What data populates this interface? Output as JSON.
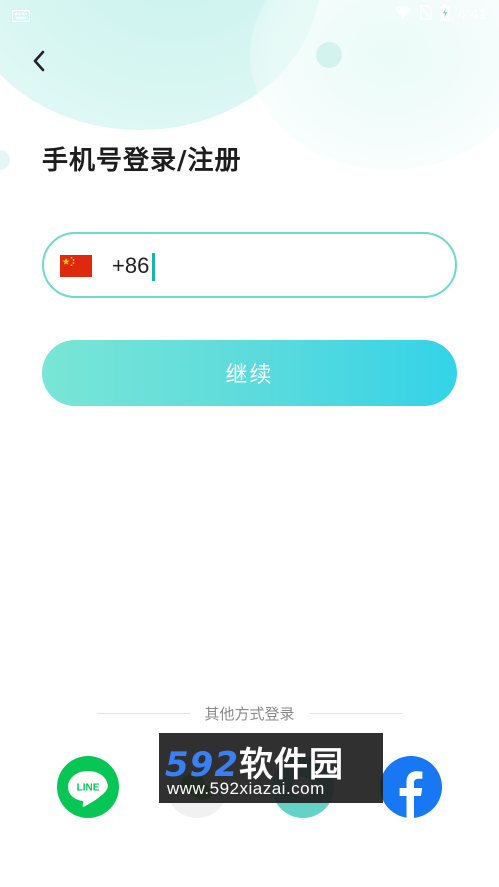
{
  "status_bar": {
    "time": "4:41"
  },
  "page": {
    "title": "手机号登录/注册"
  },
  "phone": {
    "country_code": "+86",
    "flag": "cn-flag"
  },
  "actions": {
    "continue_label": "继续"
  },
  "other_login": {
    "label": "其他方式登录",
    "providers": [
      {
        "name": "LINE",
        "color": "#06c755"
      },
      {
        "name": "wechat",
        "color": "#f1f1f1"
      },
      {
        "name": "other",
        "color": "#63d3c8"
      },
      {
        "name": "facebook",
        "color": "#1877f2"
      }
    ]
  },
  "watermark": {
    "brand_num": "592",
    "brand_cn": "软件园",
    "url": "www.592xiazai.com"
  },
  "colors": {
    "accent": "#6fd8cf",
    "button_start": "#79e6d6",
    "button_end": "#33d3e8"
  }
}
